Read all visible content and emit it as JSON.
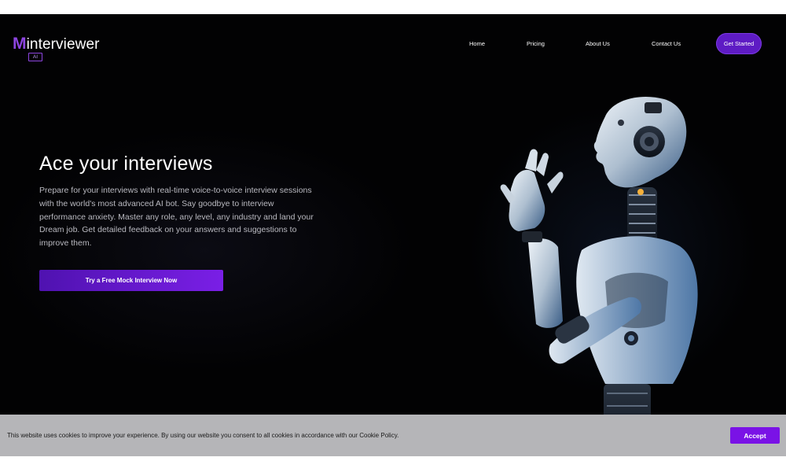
{
  "brand": {
    "logo_letter": "M",
    "logo_name": "interviewer",
    "logo_badge": "AI",
    "accent_color": "#8d45e0"
  },
  "nav": {
    "links": [
      "Home",
      "Pricing",
      "About Us",
      "Contact Us"
    ],
    "cta_label": "Get Started",
    "cta_color": "#5e1bc4"
  },
  "hero": {
    "title": "Ace your interviews",
    "description": "Prepare for your interviews with real-time voice-to-voice interview sessions with the world's most advanced AI bot. Say goodbye to interview performance anxiety. Master any role, any level, any industry and land your Dream job. Get detailed feedback on your answers and suggestions to improve them.",
    "cta_label": "Try a Free Mock Interview Now",
    "background_color": "#020203",
    "image": "humanoid-robot-illustration"
  },
  "cookie_banner": {
    "text": "This website uses cookies to improve your experience. By using our website you consent to all cookies in accordance with our Cookie Policy.",
    "accept_label": "Accept",
    "accept_color": "#7a12e6"
  }
}
